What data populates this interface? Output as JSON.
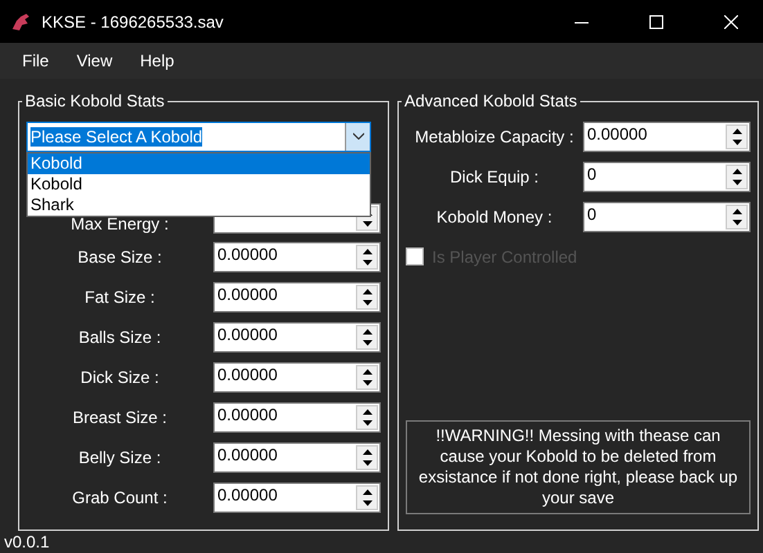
{
  "window": {
    "title": "KKSE - 1696265533.sav"
  },
  "menu": [
    "File",
    "View",
    "Help"
  ],
  "basic": {
    "title": "Basic Kobold Stats",
    "select": {
      "value": "Please Select A Kobold",
      "expanded": true,
      "options": [
        {
          "label": "Kobold",
          "selected": true
        },
        {
          "label": "Kobold",
          "selected": false
        },
        {
          "label": "Shark",
          "selected": false
        }
      ]
    },
    "fields": [
      {
        "label": "Max Energy :"
      },
      {
        "label": "Base Size :",
        "value": "0.00000"
      },
      {
        "label": "Fat Size :",
        "value": "0.00000"
      },
      {
        "label": "Balls Size :",
        "value": "0.00000"
      },
      {
        "label": "Dick Size :",
        "value": "0.00000"
      },
      {
        "label": "Breast Size :",
        "value": "0.00000"
      },
      {
        "label": "Belly Size :",
        "value": "0.00000"
      },
      {
        "label": "Grab Count :",
        "value": "0.00000"
      }
    ]
  },
  "advanced": {
    "title": "Advanced Kobold Stats",
    "fields": [
      {
        "label": "Metabloize Capacity :",
        "value": "0.00000"
      },
      {
        "label": "Dick Equip :",
        "value": "0"
      },
      {
        "label": "Kobold Money :",
        "value": "0"
      }
    ],
    "checkbox": {
      "label": "Is Player Controlled",
      "checked": false,
      "disabled": true
    },
    "warning": "!!WARNING!! Messing with thease can cause your Kobold to be deleted from exsistance if not done right, please back up your save"
  },
  "version": "v0.0.1"
}
